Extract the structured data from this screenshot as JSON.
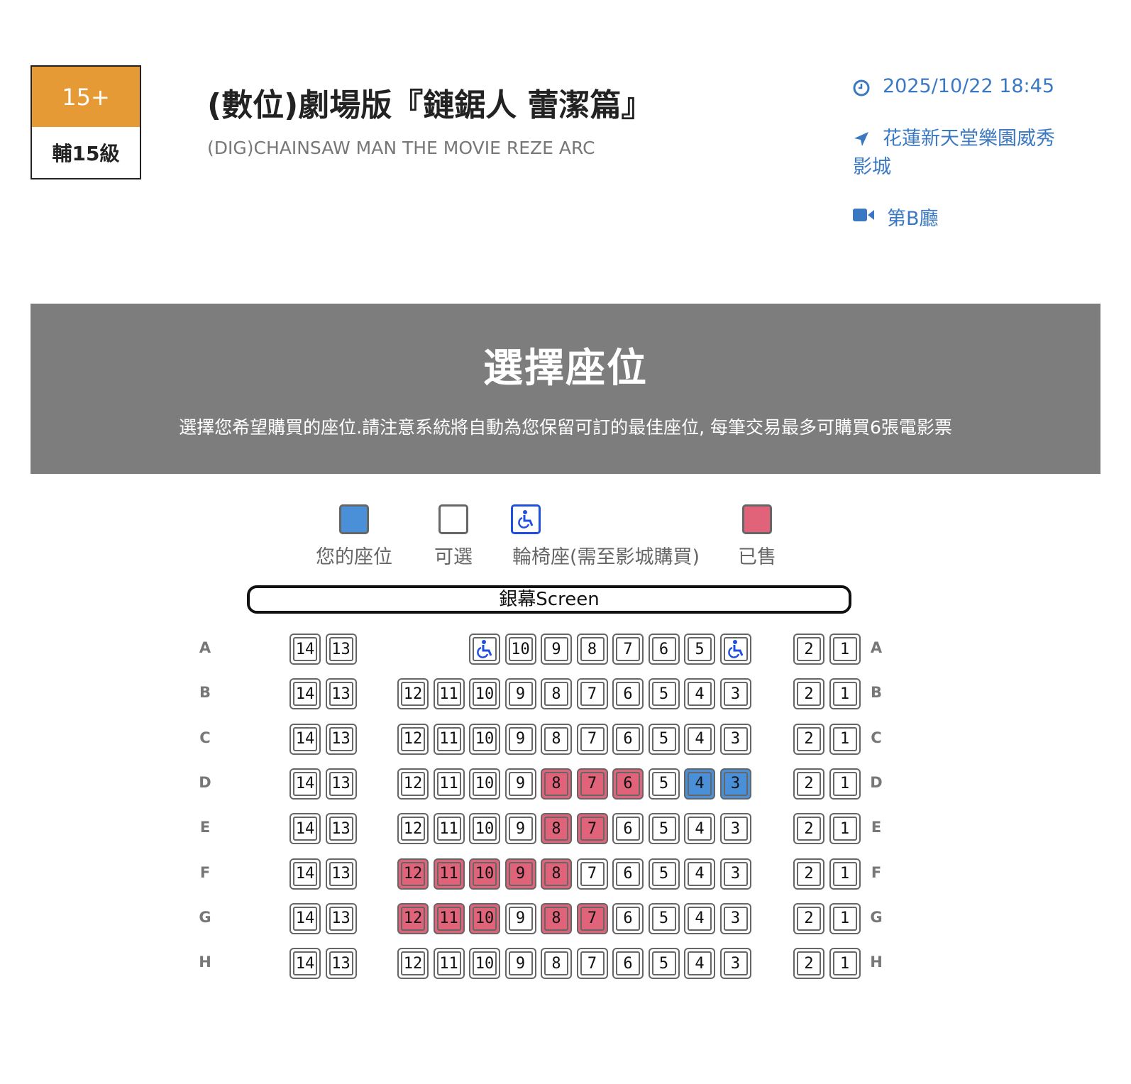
{
  "rating": {
    "badge": "15+",
    "label": "輔15級",
    "color": "#e59a36"
  },
  "movie": {
    "title": "(數位)劇場版『鏈鋸人 蕾潔篇』",
    "subtitle": "(DIG)CHAINSAW MAN THE MOVIE REZE ARC"
  },
  "session": {
    "datetime": "2025/10/22 18:45",
    "cinema": "花蓮新天堂樂園威秀影城",
    "hall": "第B廳",
    "icons": [
      "clock-icon",
      "location-arrow-icon",
      "video-camera-icon"
    ]
  },
  "banner": {
    "title": "選擇座位",
    "note": "選擇您希望購買的座位.請注意系統將自動為您保留可訂的最佳座位, 每筆交易最多可購買6張電影票"
  },
  "legend": [
    {
      "key": "mine",
      "label": "您的座位",
      "color": "#4a90d9"
    },
    {
      "key": "available",
      "label": "可選",
      "color": "#ffffff"
    },
    {
      "key": "wheelchair",
      "label": "輪椅座(需至影城購買)",
      "icon": "wheelchair-icon"
    },
    {
      "key": "sold",
      "label": "已售",
      "color": "#e0637a"
    }
  ],
  "screen_label": "銀幕Screen",
  "seating": {
    "rows": [
      {
        "label": "A",
        "seats": [
          {
            "n": "14",
            "s": "available"
          },
          {
            "n": "13",
            "s": "available"
          },
          {
            "n": "",
            "s": "wheelchair"
          },
          {
            "n": "10",
            "s": "available"
          },
          {
            "n": "9",
            "s": "available"
          },
          {
            "n": "8",
            "s": "available"
          },
          {
            "n": "7",
            "s": "available"
          },
          {
            "n": "6",
            "s": "available"
          },
          {
            "n": "5",
            "s": "available"
          },
          {
            "n": "",
            "s": "wheelchair"
          },
          {
            "n": "2",
            "s": "available"
          },
          {
            "n": "1",
            "s": "available"
          }
        ]
      },
      {
        "label": "B",
        "seats": [
          {
            "n": "14",
            "s": "available"
          },
          {
            "n": "13",
            "s": "available"
          },
          {
            "n": "12",
            "s": "available"
          },
          {
            "n": "11",
            "s": "available"
          },
          {
            "n": "10",
            "s": "available"
          },
          {
            "n": "9",
            "s": "available"
          },
          {
            "n": "8",
            "s": "available"
          },
          {
            "n": "7",
            "s": "available"
          },
          {
            "n": "6",
            "s": "available"
          },
          {
            "n": "5",
            "s": "available"
          },
          {
            "n": "4",
            "s": "available"
          },
          {
            "n": "3",
            "s": "available"
          },
          {
            "n": "2",
            "s": "available"
          },
          {
            "n": "1",
            "s": "available"
          }
        ]
      },
      {
        "label": "C",
        "seats": [
          {
            "n": "14",
            "s": "available"
          },
          {
            "n": "13",
            "s": "available"
          },
          {
            "n": "12",
            "s": "available"
          },
          {
            "n": "11",
            "s": "available"
          },
          {
            "n": "10",
            "s": "available"
          },
          {
            "n": "9",
            "s": "available"
          },
          {
            "n": "8",
            "s": "available"
          },
          {
            "n": "7",
            "s": "available"
          },
          {
            "n": "6",
            "s": "available"
          },
          {
            "n": "5",
            "s": "available"
          },
          {
            "n": "4",
            "s": "available"
          },
          {
            "n": "3",
            "s": "available"
          },
          {
            "n": "2",
            "s": "available"
          },
          {
            "n": "1",
            "s": "available"
          }
        ]
      },
      {
        "label": "D",
        "seats": [
          {
            "n": "14",
            "s": "available"
          },
          {
            "n": "13",
            "s": "available"
          },
          {
            "n": "12",
            "s": "available"
          },
          {
            "n": "11",
            "s": "available"
          },
          {
            "n": "10",
            "s": "available"
          },
          {
            "n": "9",
            "s": "available"
          },
          {
            "n": "8",
            "s": "sold"
          },
          {
            "n": "7",
            "s": "sold"
          },
          {
            "n": "6",
            "s": "sold"
          },
          {
            "n": "5",
            "s": "available"
          },
          {
            "n": "4",
            "s": "mine"
          },
          {
            "n": "3",
            "s": "mine"
          },
          {
            "n": "2",
            "s": "available"
          },
          {
            "n": "1",
            "s": "available"
          }
        ]
      },
      {
        "label": "E",
        "seats": [
          {
            "n": "14",
            "s": "available"
          },
          {
            "n": "13",
            "s": "available"
          },
          {
            "n": "12",
            "s": "available"
          },
          {
            "n": "11",
            "s": "available"
          },
          {
            "n": "10",
            "s": "available"
          },
          {
            "n": "9",
            "s": "available"
          },
          {
            "n": "8",
            "s": "sold"
          },
          {
            "n": "7",
            "s": "sold"
          },
          {
            "n": "6",
            "s": "available"
          },
          {
            "n": "5",
            "s": "available"
          },
          {
            "n": "4",
            "s": "available"
          },
          {
            "n": "3",
            "s": "available"
          },
          {
            "n": "2",
            "s": "available"
          },
          {
            "n": "1",
            "s": "available"
          }
        ]
      },
      {
        "label": "F",
        "seats": [
          {
            "n": "14",
            "s": "available"
          },
          {
            "n": "13",
            "s": "available"
          },
          {
            "n": "12",
            "s": "sold"
          },
          {
            "n": "11",
            "s": "sold"
          },
          {
            "n": "10",
            "s": "sold"
          },
          {
            "n": "9",
            "s": "sold"
          },
          {
            "n": "8",
            "s": "sold"
          },
          {
            "n": "7",
            "s": "available"
          },
          {
            "n": "6",
            "s": "available"
          },
          {
            "n": "5",
            "s": "available"
          },
          {
            "n": "4",
            "s": "available"
          },
          {
            "n": "3",
            "s": "available"
          },
          {
            "n": "2",
            "s": "available"
          },
          {
            "n": "1",
            "s": "available"
          }
        ]
      },
      {
        "label": "G",
        "seats": [
          {
            "n": "14",
            "s": "available"
          },
          {
            "n": "13",
            "s": "available"
          },
          {
            "n": "12",
            "s": "sold"
          },
          {
            "n": "11",
            "s": "sold"
          },
          {
            "n": "10",
            "s": "sold"
          },
          {
            "n": "9",
            "s": "available"
          },
          {
            "n": "8",
            "s": "sold"
          },
          {
            "n": "7",
            "s": "sold"
          },
          {
            "n": "6",
            "s": "available"
          },
          {
            "n": "5",
            "s": "available"
          },
          {
            "n": "4",
            "s": "available"
          },
          {
            "n": "3",
            "s": "available"
          },
          {
            "n": "2",
            "s": "available"
          },
          {
            "n": "1",
            "s": "available"
          }
        ]
      },
      {
        "label": "H",
        "seats": [
          {
            "n": "14",
            "s": "available"
          },
          {
            "n": "13",
            "s": "available"
          },
          {
            "n": "12",
            "s": "available"
          },
          {
            "n": "11",
            "s": "available"
          },
          {
            "n": "10",
            "s": "available"
          },
          {
            "n": "9",
            "s": "available"
          },
          {
            "n": "8",
            "s": "available"
          },
          {
            "n": "7",
            "s": "available"
          },
          {
            "n": "6",
            "s": "available"
          },
          {
            "n": "5",
            "s": "available"
          },
          {
            "n": "4",
            "s": "available"
          },
          {
            "n": "3",
            "s": "available"
          },
          {
            "n": "2",
            "s": "available"
          },
          {
            "n": "1",
            "s": "available"
          }
        ]
      }
    ]
  }
}
